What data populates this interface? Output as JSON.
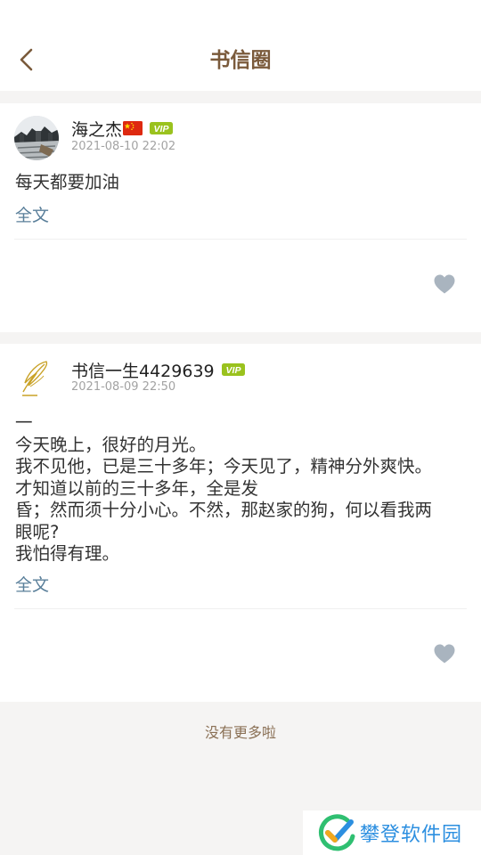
{
  "header": {
    "title": "书信圈",
    "back_icon": "chevron-left-icon"
  },
  "posts": [
    {
      "author": "海之杰",
      "has_flag": true,
      "vip_label": "VIP",
      "time": "2021-08-10 22:02",
      "content": "每天都要加油",
      "full_text_label": "全文"
    },
    {
      "author": "书信一生4429639",
      "has_flag": false,
      "vip_label": "VIP",
      "time": "2021-08-09 22:50",
      "content": "一\n今天晚上，很好的月光。\n我不见他，已是三十多年；今天见了，精神分外爽快。\n才知道以前的三十多年，全是发\n昏；然而须十分小心。不然，那赵家的狗，何以看我两\n眼呢?\n我怕得有理。",
      "full_text_label": "全文"
    }
  ],
  "footer": {
    "no_more": "没有更多啦"
  },
  "watermark": {
    "text": "攀登软件园"
  },
  "colors": {
    "accent": "#7a5a3b",
    "link": "#5a7f9a",
    "vip": "#9ac21e",
    "like": "#a9b4bf"
  }
}
